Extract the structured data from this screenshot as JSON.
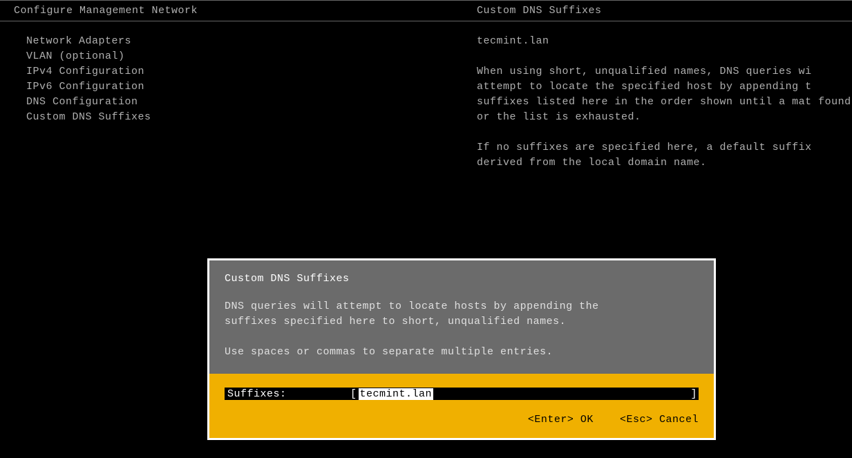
{
  "header": {
    "left_title": "Configure Management Network",
    "right_title": "Custom DNS Suffixes"
  },
  "menu": {
    "items": [
      "Network Adapters",
      "VLAN (optional)",
      "",
      "IPv4 Configuration",
      "IPv6 Configuration",
      "DNS Configuration",
      "Custom DNS Suffixes"
    ]
  },
  "detail": {
    "domain": "tecmint.lan",
    "paragraph1": "When using short, unqualified names, DNS queries wi attempt to locate the specified host by appending t suffixes listed here in the order shown until a mat found or the list is exhausted.",
    "paragraph2": "If no suffixes are specified here, a default suffix derived from the local domain name."
  },
  "dialog": {
    "title": "Custom DNS Suffixes",
    "desc_line1": "DNS queries will attempt to locate hosts by appending the",
    "desc_line2": "suffixes specified here to short, unqualified names.",
    "hint": "Use spaces or commas to separate multiple entries.",
    "field_label": "Suffixes:",
    "field_value": "tecmint.lan",
    "bracket_open": "[ ",
    "bracket_close": " ]",
    "ok_key": "<Enter>",
    "ok_label": "OK",
    "cancel_key": "<Esc>",
    "cancel_label": "Cancel"
  }
}
